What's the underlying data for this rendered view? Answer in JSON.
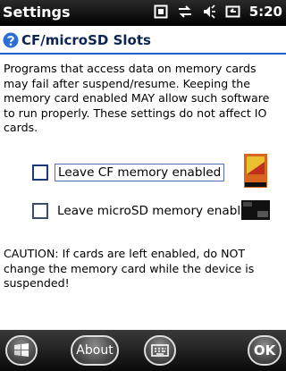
{
  "status_bar": {
    "title": "Settings",
    "time": "5:20",
    "icons": [
      "clipboard-icon",
      "connectivity-icon",
      "volume-icon",
      "battery-icon"
    ]
  },
  "page": {
    "title": "CF/microSD Slots",
    "icon": "help-icon",
    "accent_color": "#1f5fc9"
  },
  "description": "Programs that access data on memory cards\nmay fail after suspend/resume. Keeping the\nmemory card enabled MAY allow such software\nto run properly.  These settings do not affect IO\ncards.",
  "options": [
    {
      "label": "Leave CF memory enabled",
      "checked": false,
      "focused": true,
      "icon": "cf-card-icon"
    },
    {
      "label": "Leave microSD memory enabled",
      "checked": false,
      "focused": false,
      "icon": "microsd-card-icon"
    }
  ],
  "caution": "CAUTION: If cards are left enabled, do NOT\nchange the memory card while the device is\nsuspended!",
  "bottom_bar": {
    "start_icon": "windows-start-icon",
    "about_label": "About",
    "keyboard_icon": "keyboard-icon",
    "ok_label": "OK"
  }
}
